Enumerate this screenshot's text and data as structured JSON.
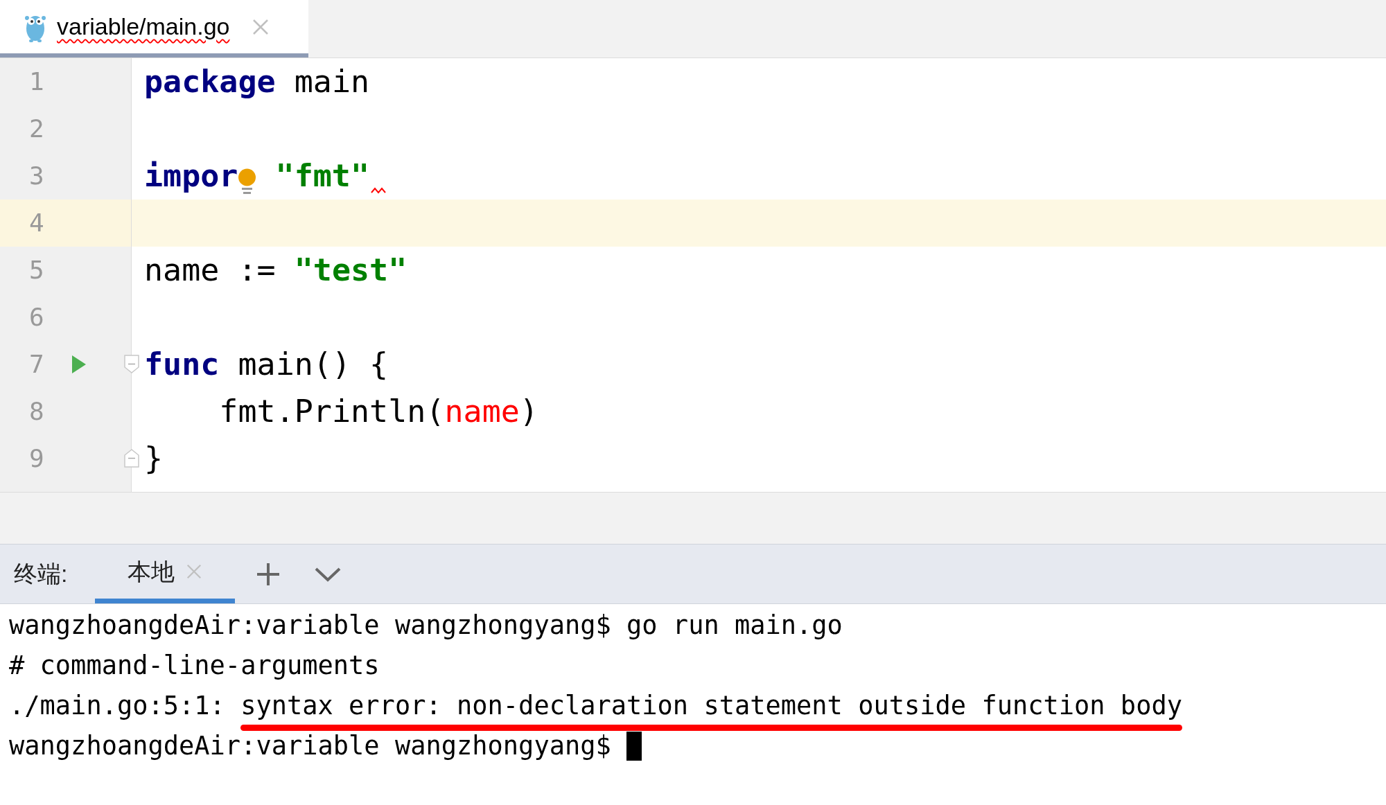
{
  "editor_tabs": [
    {
      "label": "variable/main.go",
      "selected": true,
      "error": true
    }
  ],
  "code_lines": [
    {
      "number": "1",
      "current": false,
      "tokens": [
        {
          "text": "package",
          "kind": "keyword"
        },
        {
          "text": " main",
          "kind": "plain"
        }
      ]
    },
    {
      "number": "2",
      "current": false
    },
    {
      "number": "3",
      "current": false,
      "squiggle": true,
      "tokens": [
        {
          "text": "impor",
          "kind": "keyword"
        },
        {
          "kind": "bulb"
        },
        {
          "text": " \"fmt\"",
          "kind": "string"
        }
      ]
    },
    {
      "number": "4",
      "current": true
    },
    {
      "number": "5",
      "current": false,
      "tokens": [
        {
          "text": "name := ",
          "kind": "plain"
        },
        {
          "text": "\"test\"",
          "kind": "string"
        }
      ]
    },
    {
      "number": "6",
      "current": false
    },
    {
      "number": "7",
      "current": false,
      "run": true,
      "fold_start": true,
      "tokens": [
        {
          "text": "func",
          "kind": "keyword"
        },
        {
          "text": " main() {",
          "kind": "plain"
        }
      ]
    },
    {
      "number": "8",
      "current": false,
      "tokens": [
        {
          "text": "    fmt.Println(",
          "kind": "plain"
        },
        {
          "text": "name",
          "kind": "unresolved"
        },
        {
          "text": ")",
          "kind": "plain"
        }
      ]
    },
    {
      "number": "9",
      "current": false,
      "fold_end": true,
      "tokens": [
        {
          "text": "}",
          "kind": "plain"
        }
      ]
    }
  ],
  "terminal": {
    "label": "终端:",
    "tabs": [
      {
        "label": "本地",
        "selected": true
      }
    ],
    "lines": [
      {
        "segments": [
          {
            "text": "wangzhoangdeAir:variable wangzhongyang$ go run main.go",
            "underlined": false
          }
        ]
      },
      {
        "segments": [
          {
            "text": "# command-line-arguments",
            "underlined": false
          }
        ]
      },
      {
        "segments": [
          {
            "text": "./main.go:5:1: ",
            "underlined": false
          },
          {
            "text": "syntax error: non-declaration statement outside function body",
            "underlined": true
          }
        ]
      },
      {
        "segments": [
          {
            "text": "wangzhoangdeAir:variable wangzhongyang$ ",
            "underlined": false
          }
        ],
        "cursor": true
      }
    ]
  }
}
